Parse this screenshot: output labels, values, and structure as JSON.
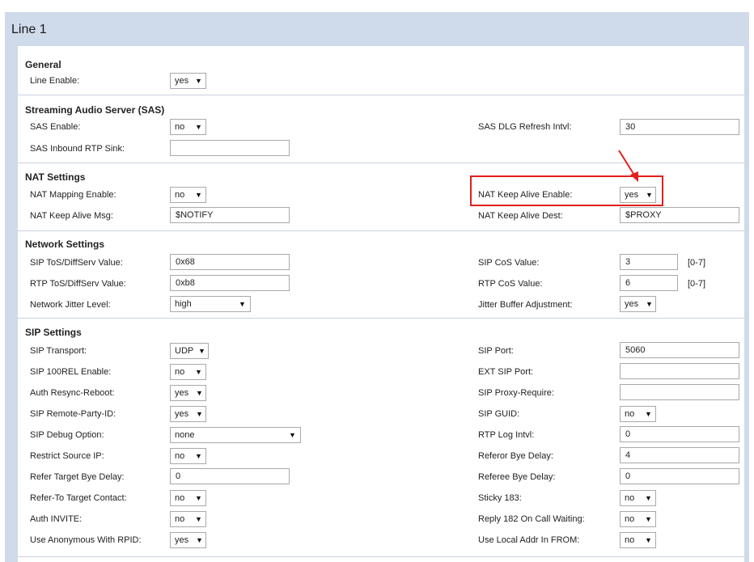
{
  "page": {
    "title": "Line 1"
  },
  "sections": {
    "general": "General",
    "sas": "Streaming Audio Server (SAS)",
    "nat": "NAT Settings",
    "network": "Network Settings",
    "sip": "SIP Settings"
  },
  "general": {
    "line_enable": {
      "label": "Line Enable:",
      "value": "yes"
    }
  },
  "sas": {
    "sas_enable": {
      "label": "SAS Enable:",
      "value": "no"
    },
    "sas_dlg_refresh": {
      "label": "SAS DLG Refresh Intvl:",
      "value": "30"
    },
    "sas_inbound_rtp_sink": {
      "label": "SAS Inbound RTP Sink:",
      "value": ""
    }
  },
  "nat": {
    "nat_mapping_enable": {
      "label": "NAT Mapping Enable:",
      "value": "no"
    },
    "nat_keep_alive_enable": {
      "label": "NAT Keep Alive Enable:",
      "value": "yes"
    },
    "nat_keep_alive_msg": {
      "label": "NAT Keep Alive Msg:",
      "value": "$NOTIFY"
    },
    "nat_keep_alive_dest": {
      "label": "NAT Keep Alive Dest:",
      "value": "$PROXY"
    }
  },
  "network": {
    "sip_tos": {
      "label": "SIP ToS/DiffServ Value:",
      "value": "0x68"
    },
    "sip_cos": {
      "label": "SIP CoS Value:",
      "value": "3",
      "hint": "[0-7]"
    },
    "rtp_tos": {
      "label": "RTP ToS/DiffServ Value:",
      "value": "0xb8"
    },
    "rtp_cos": {
      "label": "RTP CoS Value:",
      "value": "6",
      "hint": "[0-7]"
    },
    "jitter_level": {
      "label": "Network Jitter Level:",
      "value": "high"
    },
    "jitter_adjust": {
      "label": "Jitter Buffer Adjustment:",
      "value": "yes"
    }
  },
  "sip": {
    "transport": {
      "label": "SIP Transport:",
      "value": "UDP"
    },
    "port": {
      "label": "SIP Port:",
      "value": "5060"
    },
    "rel100": {
      "label": "SIP 100REL Enable:",
      "value": "no"
    },
    "ext_port": {
      "label": "EXT SIP Port:",
      "value": ""
    },
    "auth_resync": {
      "label": "Auth Resync-Reboot:",
      "value": "yes"
    },
    "proxy_require": {
      "label": "SIP Proxy-Require:",
      "value": ""
    },
    "remote_party_id": {
      "label": "SIP Remote-Party-ID:",
      "value": "yes"
    },
    "guid": {
      "label": "SIP GUID:",
      "value": "no"
    },
    "debug_option": {
      "label": "SIP Debug Option:",
      "value": "none"
    },
    "rtp_log": {
      "label": "RTP Log Intvl:",
      "value": "0"
    },
    "restrict_ip": {
      "label": "Restrict Source IP:",
      "value": "no"
    },
    "referor_bye": {
      "label": "Referor Bye Delay:",
      "value": "4"
    },
    "refer_target_bye": {
      "label": "Refer Target Bye Delay:",
      "value": "0"
    },
    "referee_bye": {
      "label": "Referee Bye Delay:",
      "value": "0"
    },
    "refer_to_target": {
      "label": "Refer-To Target Contact:",
      "value": "no"
    },
    "sticky_183": {
      "label": "Sticky 183:",
      "value": "no"
    },
    "auth_invite": {
      "label": "Auth INVITE:",
      "value": "no"
    },
    "reply_182": {
      "label": "Reply 182 On Call Waiting:",
      "value": "no"
    },
    "anon_rpid": {
      "label": "Use Anonymous With RPID:",
      "value": "yes"
    },
    "local_addr_from": {
      "label": "Use Local Addr In FROM:",
      "value": "no"
    }
  },
  "icons": {
    "dropdown": "▼"
  },
  "colors": {
    "header_bg": "#cfdaea",
    "highlight": "#e0201c"
  }
}
